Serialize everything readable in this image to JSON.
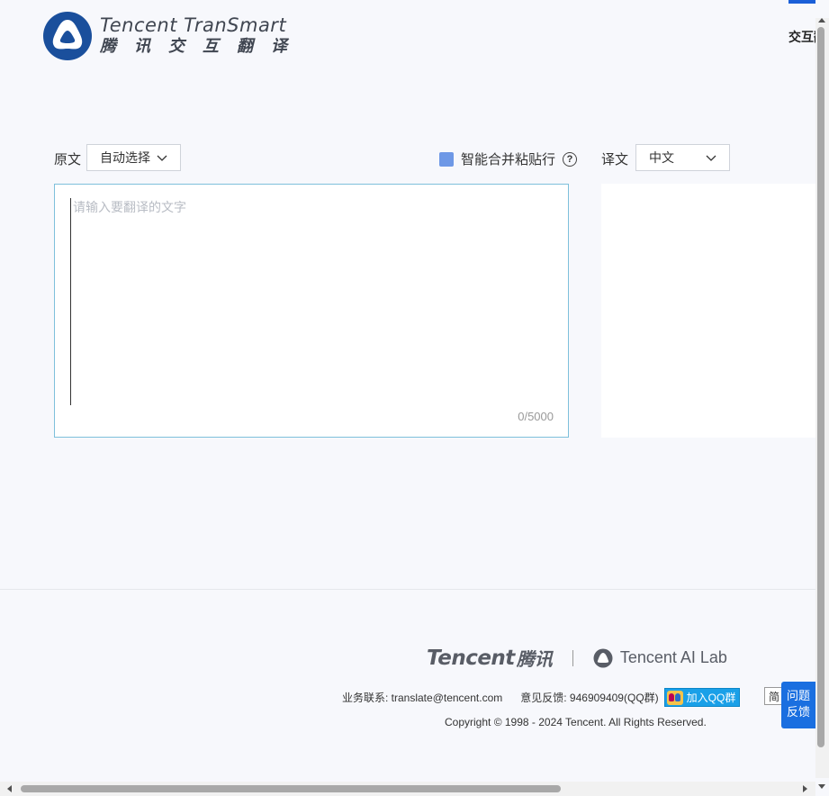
{
  "header": {
    "logo_en": "Tencent TranSmart",
    "logo_cn": "腾讯交互翻译",
    "nav_partial": "交互翻"
  },
  "source": {
    "label": "原文",
    "language": "自动选择",
    "placeholder": "请输入要翻译的文字",
    "counter": "0/5000"
  },
  "merge_option": {
    "label": "智能合并粘贴行",
    "help": "?"
  },
  "target": {
    "label": "译文",
    "language": "中文"
  },
  "footer": {
    "tencent_en": "Tencent",
    "tencent_cn": "腾讯",
    "ailab": "Tencent AI Lab",
    "contact": "业务联系: translate@tencent.com",
    "feedback": "意见反馈: 946909409(QQ群)",
    "qq_button": "加入QQ群",
    "lang_toggle": "简",
    "copyright": "Copyright © 1998 - 2024 Tencent. All Rights Reserved."
  },
  "float_feedback": {
    "line1": "问题",
    "line2": "反馈"
  },
  "colors": {
    "accent": "#1a6fe0",
    "checkbox": "#6e98e6",
    "input_border": "#7ec0db"
  }
}
